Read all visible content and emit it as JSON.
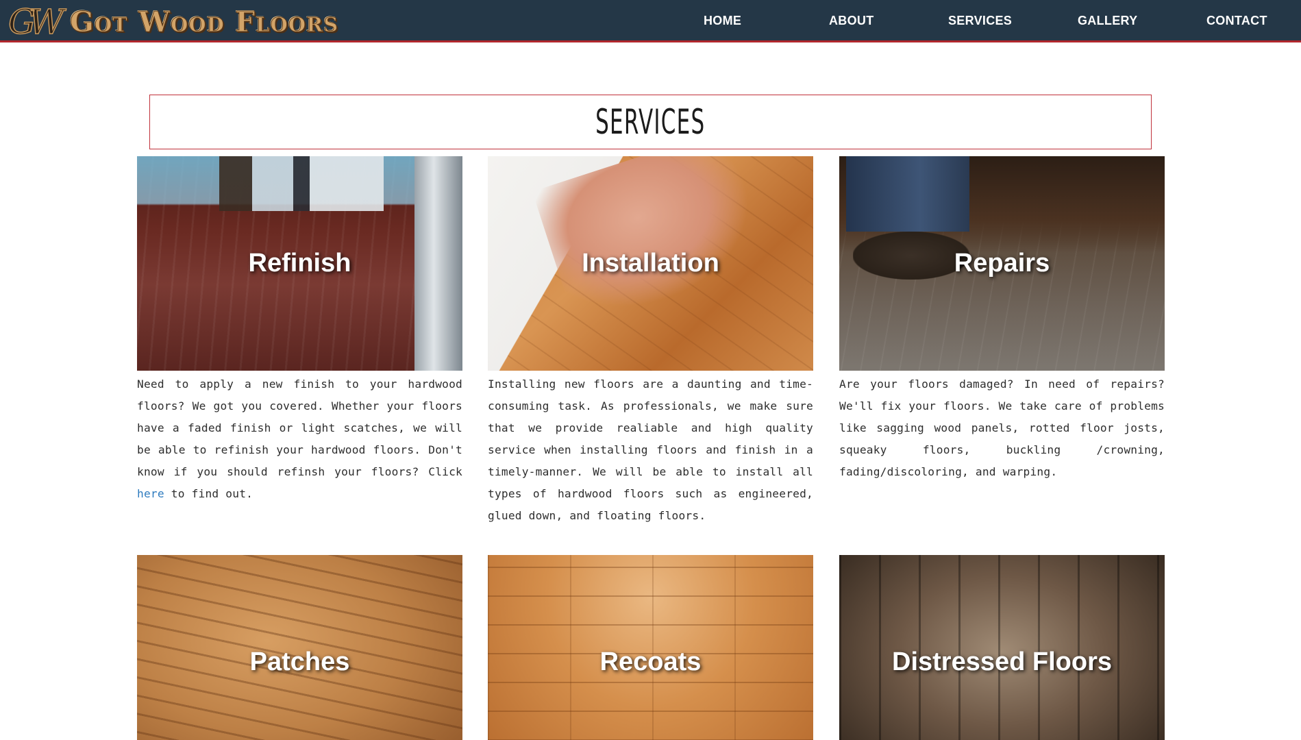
{
  "header": {
    "logo_mark": "GW",
    "logo_text": "Got Wood Floors",
    "nav": [
      {
        "label": "HOME"
      },
      {
        "label": "ABOUT"
      },
      {
        "label": "SERVICES"
      },
      {
        "label": "GALLERY"
      },
      {
        "label": "CONTACT"
      }
    ]
  },
  "page": {
    "title": "SERVICES"
  },
  "services": [
    {
      "title": "Refinish",
      "text_before_link": "Need to apply a new finish to your hardwood floors? We got you covered. Whether your floors have a faded finish or light scatches, we will be able to refinish your hardwood floors. Don't know if you should refinsh your floors? Click ",
      "link": "here",
      "text_after_link": " to find out."
    },
    {
      "title": "Installation",
      "text": "Installing new floors are a daunting and time-consuming task. As professionals, we make sure that we provide realiable and high quality service when installing floors and finish in a timely-manner. We will be able to install all types of hardwood floors such as engineered, glued down, and floating floors."
    },
    {
      "title": "Repairs",
      "text": "Are your floors damaged? In need of repairs? We'll fix your floors. We take care of problems like sagging wood panels, rotted floor josts, squeaky floors, buckling /crowning, fading/discoloring, and warping."
    },
    {
      "title": "Patches"
    },
    {
      "title": "Recoats"
    },
    {
      "title": "Distressed Floors"
    }
  ],
  "colors": {
    "header_bg": "#243747",
    "accent_red": "#b1272d",
    "link_blue": "#2e7bbf",
    "logo_gold": "#d2a469"
  }
}
